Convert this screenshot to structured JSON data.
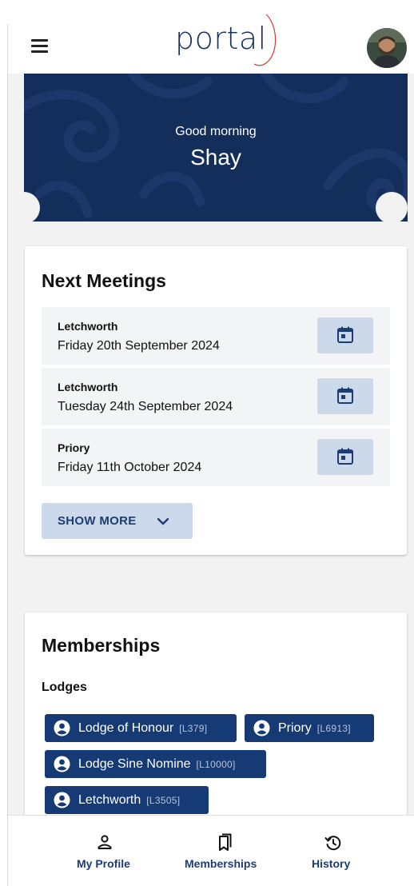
{
  "header": {
    "logo_text": "portal",
    "menu_icon": "hamburger-menu-icon",
    "avatar_icon": "user-avatar"
  },
  "hero": {
    "greeting": "Good morning",
    "name": "Shay"
  },
  "next_meetings": {
    "title": "Next Meetings",
    "items": [
      {
        "venue": "Letchworth",
        "date": "Friday 20th September 2024"
      },
      {
        "venue": "Letchworth",
        "date": "Tuesday 24th September 2024"
      },
      {
        "venue": "Priory",
        "date": "Friday 11th October 2024"
      }
    ],
    "show_more_label": "SHOW MORE"
  },
  "memberships": {
    "title": "Memberships",
    "section_label": "Lodges",
    "lodges": [
      {
        "name": "Lodge of Honour",
        "code": "[L379]"
      },
      {
        "name": "Priory",
        "code": "[L6913]"
      },
      {
        "name": "Lodge Sine Nomine",
        "code": "[L10000]"
      },
      {
        "name": "Letchworth",
        "code": "[L3505]"
      }
    ]
  },
  "bottom_nav": {
    "items": [
      {
        "label": "My Profile",
        "icon": "person-outline-icon"
      },
      {
        "label": "Memberships",
        "icon": "bookmarks-icon"
      },
      {
        "label": "History",
        "icon": "history-icon"
      }
    ]
  },
  "colors": {
    "brand_navy": "#142e5c",
    "chip_navy": "#163a73",
    "button_light_blue": "#cbd9ea",
    "nav_text": "#1d3d72",
    "logo_accent": "#d33b3b"
  }
}
